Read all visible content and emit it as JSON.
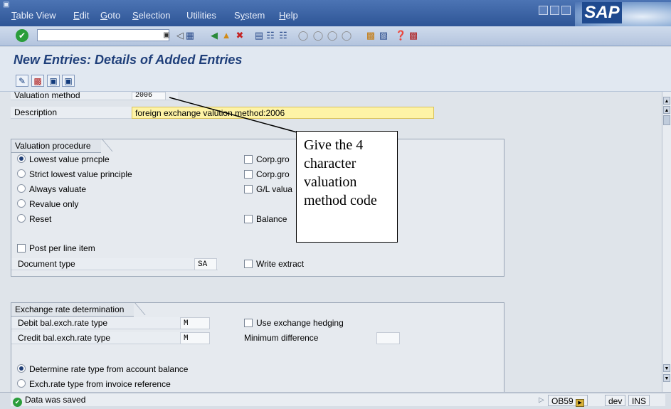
{
  "menubar": {
    "items": [
      "Table View",
      "Edit",
      "Goto",
      "Selection",
      "Utilities",
      "System",
      "Help"
    ],
    "logo": "SAP"
  },
  "toolbar": {
    "command_value": "",
    "icons": [
      "enter-icon",
      "save-icon",
      "back-icon",
      "exit-icon",
      "cancel-icon",
      "print-icon",
      "find-icon",
      "find-next-icon",
      "first-page-icon",
      "prev-page-icon",
      "next-page-icon",
      "last-page-icon",
      "new-session-icon",
      "shortcut-icon",
      "help-icon",
      "layout-icon"
    ]
  },
  "title": "New Entries: Details of Added Entries",
  "form": {
    "valuation_method_label": "Valuation method",
    "valuation_method_value": "2006",
    "description_label": "Description",
    "description_value": "foreign exchange valution method:2006"
  },
  "valuation_procedure": {
    "title": "Valuation procedure",
    "radios": [
      {
        "label": "Lowest value prncple",
        "selected": true
      },
      {
        "label": "Strict lowest value principle",
        "selected": false
      },
      {
        "label": "Always valuate",
        "selected": false
      },
      {
        "label": "Revalue only",
        "selected": false
      },
      {
        "label": "Reset",
        "selected": false
      }
    ],
    "checks": [
      "Corp.gro",
      "Corp.gro",
      "G/L valua",
      "Balance "
    ],
    "post_per_line_item": "Post per line item",
    "document_type_label": "Document type",
    "document_type_value": "SA",
    "write_extract": "Write extract"
  },
  "exchange_rate": {
    "title": "Exchange rate determination",
    "debit_label": "Debit bal.exch.rate type",
    "debit_value": "M",
    "credit_label": "Credit bal.exch.rate type",
    "credit_value": "M",
    "use_hedging": "Use exchange hedging",
    "min_diff_label": "Minimum difference",
    "min_diff_value": "",
    "radio_1": "Determine rate type from account balance",
    "radio_2": "Exch.rate type from invoice reference"
  },
  "callout": {
    "text": "Give the 4 character valuation method code"
  },
  "status": {
    "message": "Data was saved",
    "transaction": "OB59",
    "system": "dev",
    "mode": "INS"
  },
  "colors": {
    "highlight_field": "#fef3a6",
    "title_blue": "#1f3f7a"
  }
}
